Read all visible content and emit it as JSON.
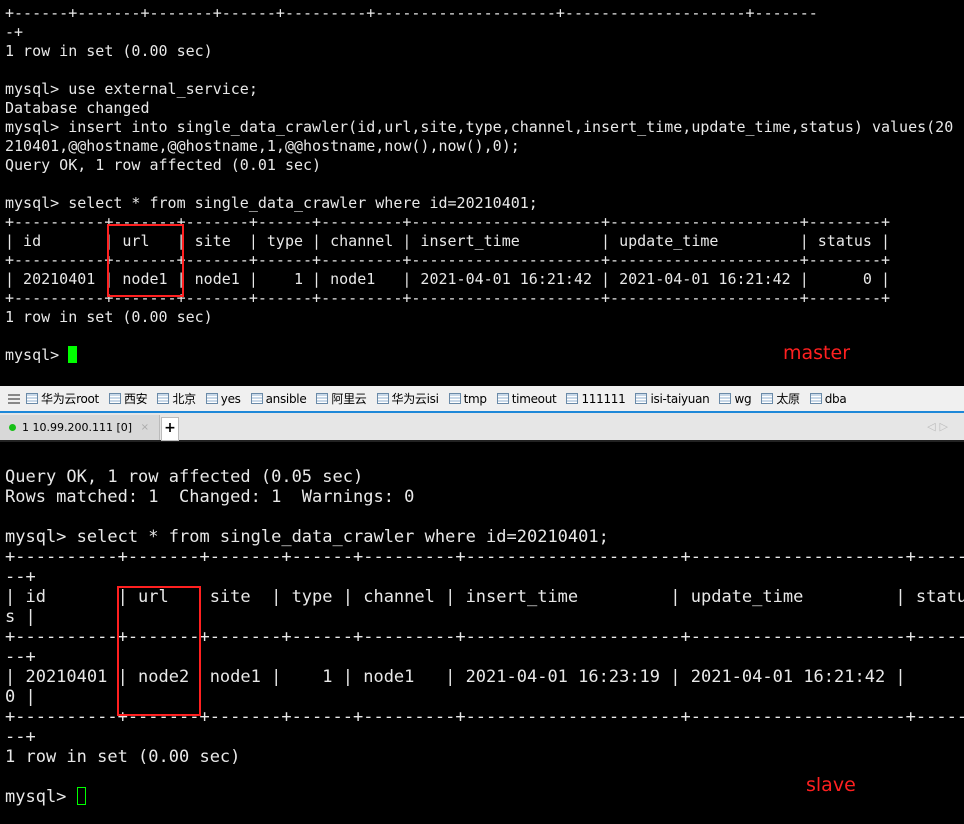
{
  "master_terminal": {
    "lines": [
      "+------+-------+-------+------+---------+--------------------+--------------------+-------",
      "-+",
      "1 row in set (0.00 sec)",
      "",
      "mysql> use external_service;",
      "Database changed",
      "mysql> insert into single_data_crawler(id,url,site,type,channel,insert_time,update_time,status) values(20",
      "210401,@@hostname,@@hostname,1,@@hostname,now(),now(),0);",
      "Query OK, 1 row affected (0.01 sec)",
      "",
      "mysql> select * from single_data_crawler where id=20210401;",
      "+----------+-------+-------+------+---------+---------------------+---------------------+--------+",
      "| id       | url   | site  | type | channel | insert_time         | update_time         | status |",
      "+----------+-------+-------+------+---------+---------------------+---------------------+--------+",
      "| 20210401 | node1 | node1 |    1 | node1   | 2021-04-01 16:21:42 | 2021-04-01 16:21:42 |      0 |",
      "+----------+-------+-------+------+---------+---------------------+---------------------+--------+",
      "1 row in set (0.00 sec)",
      ""
    ],
    "prompt": "mysql> ",
    "annotation": "master"
  },
  "bookmarks": [
    "华为云root",
    "西安",
    "北京",
    "yes",
    "ansible",
    "阿里云",
    "华为云isi",
    "tmp",
    "timeout",
    "111111",
    "isi-taiyuan",
    "wg",
    "太原",
    "dba"
  ],
  "session_tab": {
    "label": "1 10.99.200.111 [0]",
    "status_color": "#17c017",
    "close": "×",
    "add": "+"
  },
  "slave_terminal": {
    "lines": [
      "",
      "Query OK, 1 row affected (0.05 sec)",
      "Rows matched: 1  Changed: 1  Warnings: 0",
      "",
      "mysql> select * from single_data_crawler where id=20210401;",
      "+----------+-------+-------+------+---------+---------------------+---------------------+------",
      "--+",
      "| id       | url    site  | type | channel | insert_time         | update_time         | statu",
      "s |",
      "+----------+-------+-------+------+---------+---------------------+---------------------+------",
      "--+",
      "| 20210401 | node2  node1 |    1 | node1   | 2021-04-01 16:23:19 | 2021-04-01 16:21:42 |",
      "0 |",
      "+----------+-------+-------+------+---------+---------------------+---------------------+------",
      "--+",
      "1 row in set (0.00 sec)",
      ""
    ],
    "prompt": "mysql> ",
    "annotation": "slave"
  },
  "colors": {
    "highlight": "#ff2020",
    "cursor": "#00ff00",
    "accent": "#1e88d8"
  }
}
